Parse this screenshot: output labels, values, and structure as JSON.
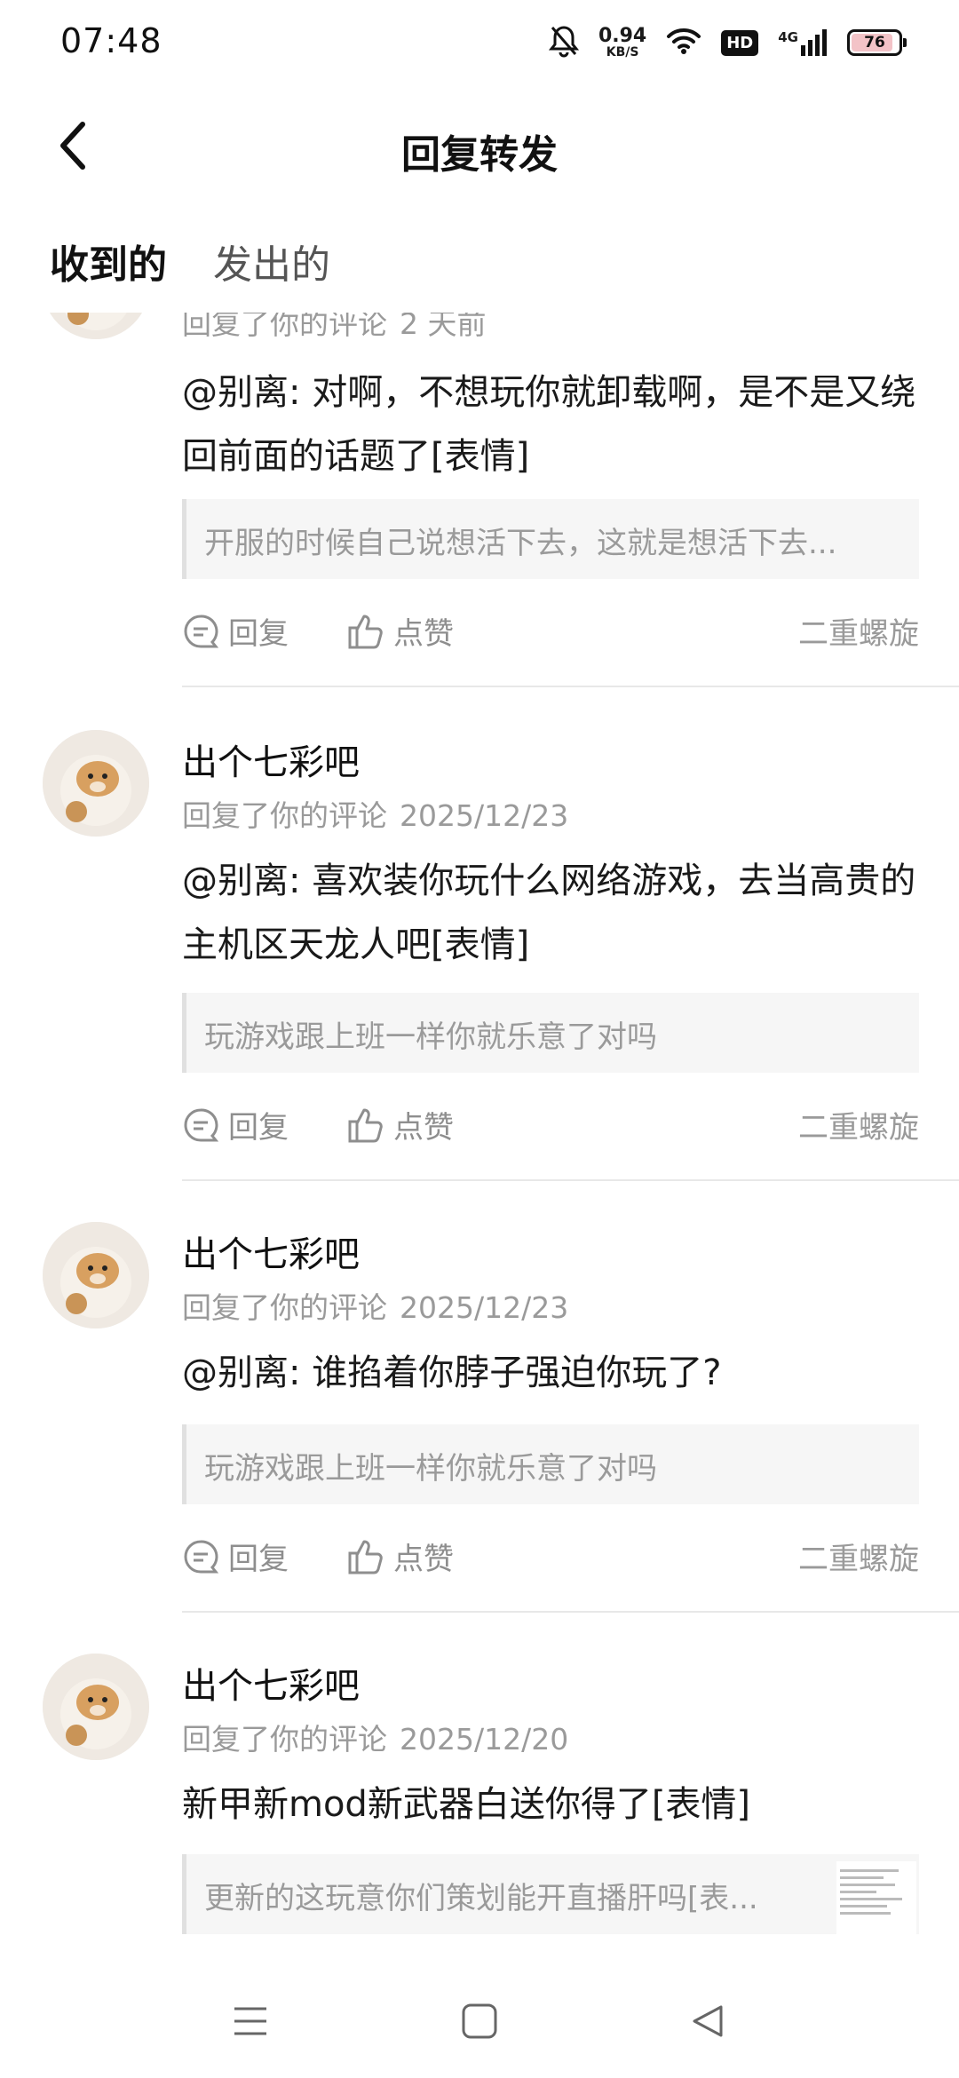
{
  "status_bar": {
    "time": "07:48",
    "net_speed": "0.94",
    "net_unit": "KB/S",
    "hd": "HD",
    "signal": "4G",
    "battery": "76",
    "icons": [
      "mute-bell-icon",
      "wifi-icon",
      "signal-icon",
      "battery-icon"
    ]
  },
  "header": {
    "title": "回复转发",
    "back_icon": "back-arrow-icon"
  },
  "tabs": [
    {
      "label": "收到的",
      "active": true
    },
    {
      "label": "发出的",
      "active": false
    }
  ],
  "accent_color": "#19c4b8",
  "comments": [
    {
      "user": "",
      "meta": "回复了你的评论",
      "time": "2 天前",
      "content": "@别离: 对啊，不想玩你就卸载啊，是不是又绕回前面的话题了[表情]",
      "quote": "开服的时候自己说想活下去，这就是想活下去...",
      "reply_label": "回复",
      "like_label": "点赞",
      "source": "二重螺旋"
    },
    {
      "user": "出个七彩吧",
      "meta": "回复了你的评论",
      "time": "2025/12/23",
      "content": "@别离: 喜欢装你玩什么网络游戏，去当高贵的主机区天龙人吧[表情]",
      "quote": "玩游戏跟上班一样你就乐意了对吗",
      "reply_label": "回复",
      "like_label": "点赞",
      "source": "二重螺旋"
    },
    {
      "user": "出个七彩吧",
      "meta": "回复了你的评论",
      "time": "2025/12/23",
      "content": "@别离: 谁掐着你脖子强迫你玩了?",
      "quote": "玩游戏跟上班一样你就乐意了对吗",
      "reply_label": "回复",
      "like_label": "点赞",
      "source": "二重螺旋"
    },
    {
      "user": "出个七彩吧",
      "meta": "回复了你的评论",
      "time": "2025/12/20",
      "content": "新甲新mod新武器白送你得了[表情]",
      "quote": "更新的这玩意你们策划能开直播肝吗[表...",
      "reply_label": "回复",
      "like_label": "点赞",
      "source": ""
    }
  ],
  "nav": [
    "menu-icon",
    "home-square-icon",
    "back-triangle-icon"
  ]
}
